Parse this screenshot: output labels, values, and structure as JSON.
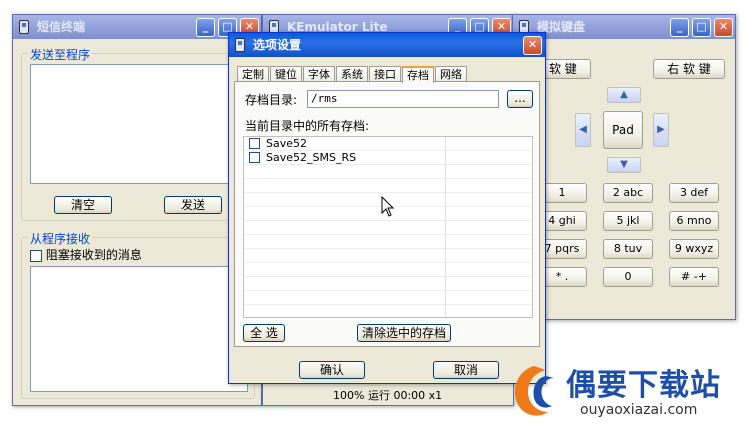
{
  "sms_window": {
    "title": "短信终端",
    "send_group_title": "发送至程序",
    "clear_button": "清空",
    "send_button": "发送",
    "receive_group_title": "从程序接收",
    "block_checkbox_label": "阻塞接收到的消息"
  },
  "emulator_window": {
    "title": "KEmulator Lite",
    "status_text": "100% 运行 00:00 x1"
  },
  "keypad_window": {
    "title": "模拟键盘",
    "left_soft_key": "左 软 键",
    "right_soft_key": "右 软 键",
    "pad_label": "Pad",
    "keys": [
      "1",
      "2 abc",
      "3 def",
      "4 ghi",
      "5 jkl",
      "6 mno",
      "7 pqrs",
      "8 tuv",
      "9 wxyz",
      "* .",
      "0",
      "# -+"
    ]
  },
  "options_dialog": {
    "title": "选项设置",
    "tabs": [
      "定制",
      "键位",
      "字体",
      "系统",
      "接口",
      "存档",
      "网络"
    ],
    "active_tab": "存档",
    "dir_label": "存档目录:",
    "dir_value": "/rms",
    "browse_button": "...",
    "list_label": "当前目录中的所有存档:",
    "saves": [
      "Save52",
      "Save52_SMS_RS"
    ],
    "select_all_button": "全 选",
    "clear_selected_button": "清除选中的存档",
    "ok_button": "确认",
    "cancel_button": "取消"
  },
  "watermark": {
    "brand_cn": "偶要下载站",
    "brand_url": "ouyaoxiazai.com"
  },
  "colors": {
    "active_title": "#0a5bd8",
    "inactive_title": "#8d9ed8",
    "window_face": "#ece9d8",
    "group_title_text": "#0046d5",
    "logo_orange": "#f07a1a",
    "logo_blue": "#1e4fa8"
  }
}
